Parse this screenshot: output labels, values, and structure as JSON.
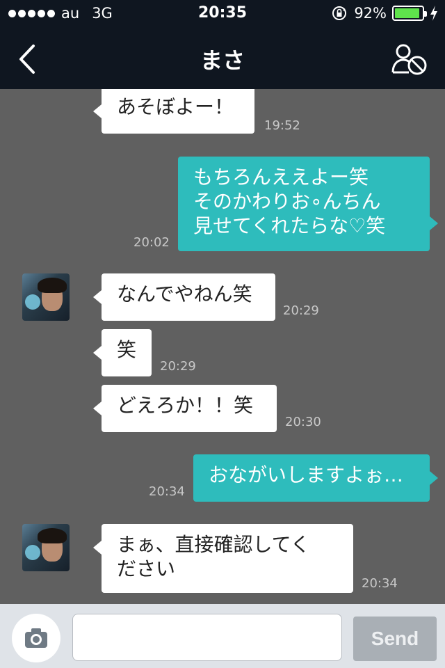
{
  "status_bar": {
    "carrier": "au",
    "network": "3G",
    "time": "20:35",
    "battery_percent": "92%",
    "battery_level": 0.92,
    "signal_dots": 5,
    "icons": [
      "rotation-lock-icon",
      "battery-icon",
      "charging-bolt-icon"
    ]
  },
  "nav": {
    "title": "まさ",
    "back_icon": "chevron-left-icon",
    "block_icon": "block-user-icon"
  },
  "messages": [
    {
      "from": "other",
      "text": "あそぼよー！",
      "time": "19:52"
    },
    {
      "from": "me",
      "text": "もちろんええよー笑\nそのかわりお∘んちん\n見せてくれたらな♡笑",
      "time": "20:02"
    },
    {
      "from": "other",
      "text": "なんでやねん笑",
      "time": "20:29"
    },
    {
      "from": "other",
      "text": "笑",
      "time": "20:29"
    },
    {
      "from": "other",
      "text": "どえろか！！笑",
      "time": "20:30"
    },
    {
      "from": "me",
      "text": "おながいしますよぉ…",
      "time": "20:34"
    },
    {
      "from": "other",
      "text": "まぁ、直接確認してく\nださい",
      "time": "20:34"
    }
  ],
  "input_bar": {
    "camera_icon": "camera-icon",
    "input_value": "",
    "send_label": "Send"
  },
  "colors": {
    "header_bg": "#0f1620",
    "chat_bg": "#606060",
    "incoming_bubble": "#ffffff",
    "outgoing_bubble": "#2ebcbc",
    "send_button": "#a9afb5",
    "battery_fill": "#5fe34c"
  }
}
